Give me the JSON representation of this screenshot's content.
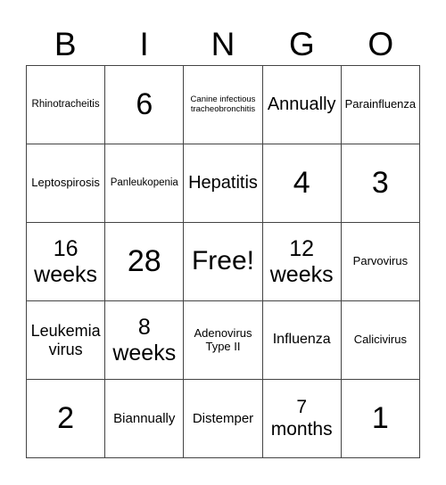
{
  "header": [
    "B",
    "I",
    "N",
    "G",
    "O"
  ],
  "cells": [
    [
      "Rhinotracheitis",
      "6",
      "Canine infectious tracheobronchitis",
      "Annually",
      "Parainfluenza"
    ],
    [
      "Leptospirosis",
      "Panleukopenia",
      "Hepatitis",
      "4",
      "3"
    ],
    [
      "16 weeks",
      "28",
      "Free!",
      "12 weeks",
      "Parvovirus"
    ],
    [
      "Leukemia virus",
      "8 weeks",
      "Adenovirus Type II",
      "Influenza",
      "Calicivirus"
    ],
    [
      "2",
      "Biannually",
      "Distemper",
      "7 months",
      "1"
    ]
  ]
}
